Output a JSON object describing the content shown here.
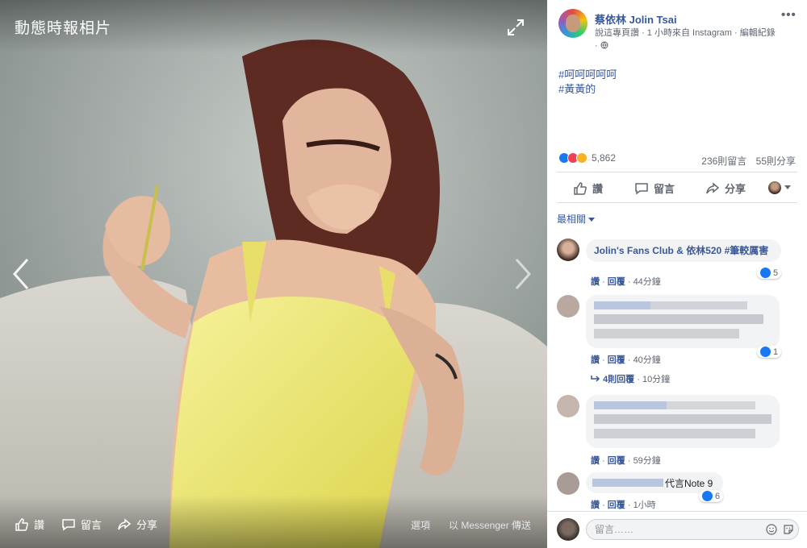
{
  "viewer": {
    "title": "動態時報相片",
    "like_label": "讚",
    "comment_label": "留言",
    "share_label": "分享",
    "options_label": "選項",
    "messenger_label": "以 Messenger 傳送"
  },
  "post": {
    "page_name": "蔡依林 Jolin Tsai",
    "meta_like": "說這專頁讚",
    "meta_time": "· 1 小時來自 Instagram · 編輯紀錄",
    "meta_dot": "·",
    "hashtags": [
      "#呵呵呵呵呵",
      "#黃黃的"
    ],
    "reaction_count": "5,862",
    "comments_count": "236則留言",
    "shares_count": "55則分享",
    "actions": {
      "like": "讚",
      "comment": "留言",
      "share": "分享"
    },
    "sort_label": "最相關",
    "more_icon": "more-dots-icon"
  },
  "comments": [
    {
      "author": "Jolin's Fans Club & 依林520",
      "text": "#筆較厲害",
      "like_label": "讚",
      "reply_label": "回覆",
      "time": "44分鐘",
      "reactions": "5"
    },
    {
      "like_label": "讚",
      "reply_label": "回覆",
      "time": "40分鐘",
      "reactions": "1",
      "replies": "4則回覆",
      "replies_time": "10分鐘"
    },
    {
      "like_label": "讚",
      "reply_label": "回覆",
      "time": "59分鐘"
    },
    {
      "visible_text": "代言Note 9",
      "like_label": "讚",
      "reply_label": "回覆",
      "time": "1小時",
      "reactions": "6"
    }
  ],
  "composer": {
    "placeholder": "留言……"
  },
  "colors": {
    "link": "#385898",
    "like_blue": "#1877f2",
    "dress_yellow": "#f2ec7a",
    "panel_bg": "#ffffff"
  }
}
